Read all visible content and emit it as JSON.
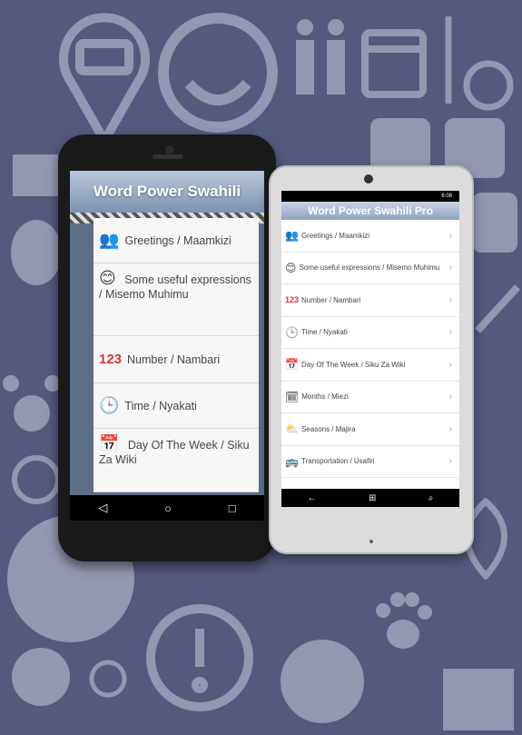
{
  "android": {
    "title": "Word Power Swahili",
    "items": [
      {
        "icon": "people-icon",
        "glyph": "👥",
        "label": "Greetings / Maamkizi"
      },
      {
        "icon": "smiley-icon",
        "glyph": "😊",
        "label": "Some useful expressions / Misemo Muhimu"
      },
      {
        "icon": "numbers-icon",
        "glyph": "123",
        "label": "Number / Nambari"
      },
      {
        "icon": "clock-icon",
        "glyph": "🕒",
        "label": "Time / Nyakati"
      },
      {
        "icon": "calendar-icon",
        "glyph": "📅",
        "label": "Day Of The Week / Siku Za Wiki"
      }
    ],
    "nav": {
      "back": "◁",
      "home": "○",
      "recent": "□"
    }
  },
  "windows": {
    "title": "Word Power Swahili Pro",
    "status_time": "6:08",
    "items": [
      {
        "icon": "people-icon",
        "glyph": "👥",
        "label": "Greetings / Maamkizi"
      },
      {
        "icon": "smiley-icon",
        "glyph": "😊",
        "label": "Some useful expressions / Misemo Muhimu"
      },
      {
        "icon": "numbers-icon",
        "glyph": "123",
        "label": "Number / Nambari"
      },
      {
        "icon": "clock-icon",
        "glyph": "🕒",
        "label": "Time / Nyakati"
      },
      {
        "icon": "calendar-icon",
        "glyph": "📅",
        "label": "Day Of The Week / Siku Za Wiki"
      },
      {
        "icon": "month-icon",
        "glyph": "🗓",
        "label": "Months / Miezi"
      },
      {
        "icon": "weather-icon",
        "glyph": "⛅",
        "label": "Seasons / Majira"
      },
      {
        "icon": "bus-icon",
        "glyph": "🚌",
        "label": "Transportation / Usafiri"
      }
    ],
    "nav": {
      "back": "←",
      "home": "⊞",
      "search": "⌕"
    }
  }
}
